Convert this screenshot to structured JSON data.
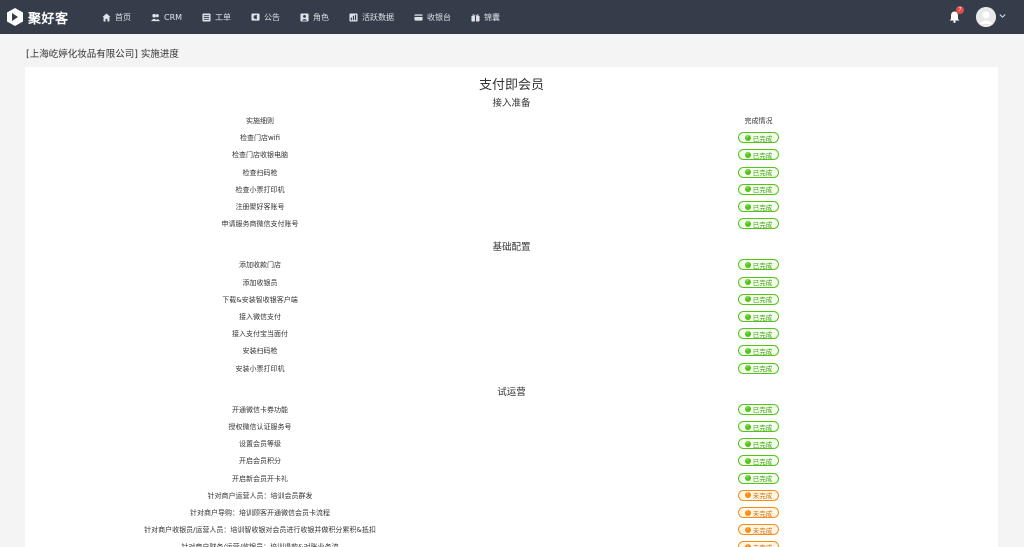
{
  "app": {
    "logo_text": "聚好客"
  },
  "nav": [
    {
      "label": "首页",
      "icon": "home-icon"
    },
    {
      "label": "CRM",
      "icon": "users-icon"
    },
    {
      "label": "工单",
      "icon": "list-icon"
    },
    {
      "label": "公告",
      "icon": "bullhorn-icon"
    },
    {
      "label": "角色",
      "icon": "user-card-icon"
    },
    {
      "label": "活跃数据",
      "icon": "chart-icon"
    },
    {
      "label": "收银台",
      "icon": "card-icon"
    },
    {
      "label": "锦囊",
      "icon": "gift-icon"
    }
  ],
  "notifications": {
    "count": "7"
  },
  "page_title": "[上海屹婷化妆品有限公司] 实施进度",
  "card_title": "支付即会员",
  "table_header": {
    "item": "实施细则",
    "status": "完成情况"
  },
  "status_labels": {
    "done": "已完成",
    "undone": "未完成"
  },
  "sections": [
    {
      "title": "接入准备",
      "items": [
        {
          "name": "检查门店wifi",
          "status": "done"
        },
        {
          "name": "检查门店收银电脑",
          "status": "done"
        },
        {
          "name": "检查扫码枪",
          "status": "done"
        },
        {
          "name": "检查小票打印机",
          "status": "done"
        },
        {
          "name": "注册聚好客账号",
          "status": "done"
        },
        {
          "name": "申请服务商微信支付账号",
          "status": "done"
        }
      ]
    },
    {
      "title": "基础配置",
      "items": [
        {
          "name": "添加收款门店",
          "status": "done"
        },
        {
          "name": "添加收银员",
          "status": "done"
        },
        {
          "name": "下载&安装智收银客户端",
          "status": "done"
        },
        {
          "name": "接入微信支付",
          "status": "done"
        },
        {
          "name": "接入支付宝当面付",
          "status": "done"
        },
        {
          "name": "安装扫码枪",
          "status": "done"
        },
        {
          "name": "安装小票打印机",
          "status": "done"
        }
      ]
    },
    {
      "title": "试运营",
      "items": [
        {
          "name": "开通微信卡券功能",
          "status": "done"
        },
        {
          "name": "授权微信认证服务号",
          "status": "done"
        },
        {
          "name": "设置会员等级",
          "status": "done"
        },
        {
          "name": "开启会员积分",
          "status": "done"
        },
        {
          "name": "开启新会员开卡礼",
          "status": "done"
        },
        {
          "name": "针对商户运营人员：培训会员群发",
          "status": "undone"
        },
        {
          "name": "针对商户导购：培训顾客开通微信会员卡流程",
          "status": "undone"
        },
        {
          "name": "针对商户收银员/运营人员：培训智收银对会员进行收银并做积分累积&抵扣",
          "status": "undone"
        },
        {
          "name": "针对商户财务/运营/收银员：培训退款&对账业务流",
          "status": "undone"
        }
      ]
    }
  ]
}
